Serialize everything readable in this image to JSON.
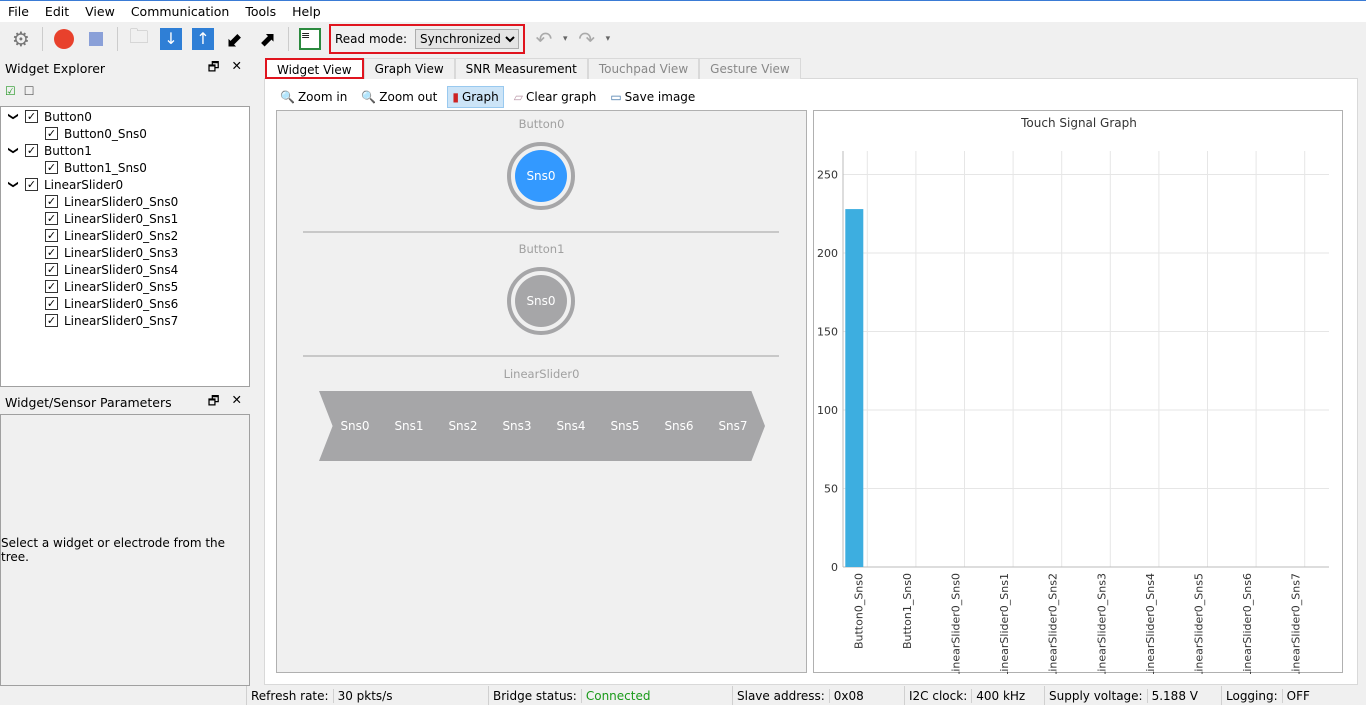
{
  "menu": [
    "File",
    "Edit",
    "View",
    "Communication",
    "Tools",
    "Help"
  ],
  "toolbar": {
    "read_mode_label": "Read mode:",
    "read_mode_value": "Synchronized"
  },
  "explorer": {
    "title": "Widget Explorer",
    "tree": [
      {
        "label": "Button0",
        "children": [
          "Button0_Sns0"
        ]
      },
      {
        "label": "Button1",
        "children": [
          "Button1_Sns0"
        ]
      },
      {
        "label": "LinearSlider0",
        "children": [
          "LinearSlider0_Sns0",
          "LinearSlider0_Sns1",
          "LinearSlider0_Sns2",
          "LinearSlider0_Sns3",
          "LinearSlider0_Sns4",
          "LinearSlider0_Sns5",
          "LinearSlider0_Sns6",
          "LinearSlider0_Sns7"
        ]
      }
    ]
  },
  "params": {
    "title": "Widget/Sensor Parameters",
    "message": "Select a widget or electrode from the tree."
  },
  "tabs": [
    {
      "label": "Widget View",
      "active": true
    },
    {
      "label": "Graph View"
    },
    {
      "label": "SNR Measurement"
    },
    {
      "label": "Touchpad View",
      "disabled": true
    },
    {
      "label": "Gesture View",
      "disabled": true
    }
  ],
  "subtoolbar": {
    "zoom_in": "Zoom in",
    "zoom_out": "Zoom out",
    "graph": "Graph",
    "clear_graph": "Clear graph",
    "save_image": "Save image"
  },
  "widgets": {
    "button0": {
      "title": "Button0",
      "sensor": "Sns0",
      "active": true,
      "color": "#3399ff"
    },
    "button1": {
      "title": "Button1",
      "sensor": "Sns0",
      "active": false
    },
    "slider": {
      "title": "LinearSlider0",
      "segments": [
        "Sns0",
        "Sns1",
        "Sns2",
        "Sns3",
        "Sns4",
        "Sns5",
        "Sns6",
        "Sns7"
      ]
    }
  },
  "chart_data": {
    "type": "bar",
    "title": "Touch Signal Graph",
    "categories": [
      "Button0_Sns0",
      "Button1_Sns0",
      "LinearSlider0_Sns0",
      "LinearSlider0_Sns1",
      "LinearSlider0_Sns2",
      "LinearSlider0_Sns3",
      "LinearSlider0_Sns4",
      "LinearSlider0_Sns5",
      "LinearSlider0_Sns6",
      "LinearSlider0_Sns7"
    ],
    "values": [
      228,
      0,
      0,
      0,
      0,
      0,
      0,
      0,
      0,
      0
    ],
    "yticks": [
      0,
      50,
      100,
      150,
      200,
      250
    ],
    "ylim": [
      0,
      265
    ],
    "grid": true,
    "bar_color": "#3daee0"
  },
  "status": [
    {
      "label": "Refresh rate:",
      "value": "30 pkts/s"
    },
    {
      "label": "Bridge status:",
      "value": "Connected",
      "color": "#1a9a1a"
    },
    {
      "label": "Slave address:",
      "value": "0x08"
    },
    {
      "label": "I2C clock:",
      "value": "400 kHz"
    },
    {
      "label": "Supply voltage:",
      "value": "5.188 V"
    },
    {
      "label": "Logging:",
      "value": "OFF"
    }
  ]
}
